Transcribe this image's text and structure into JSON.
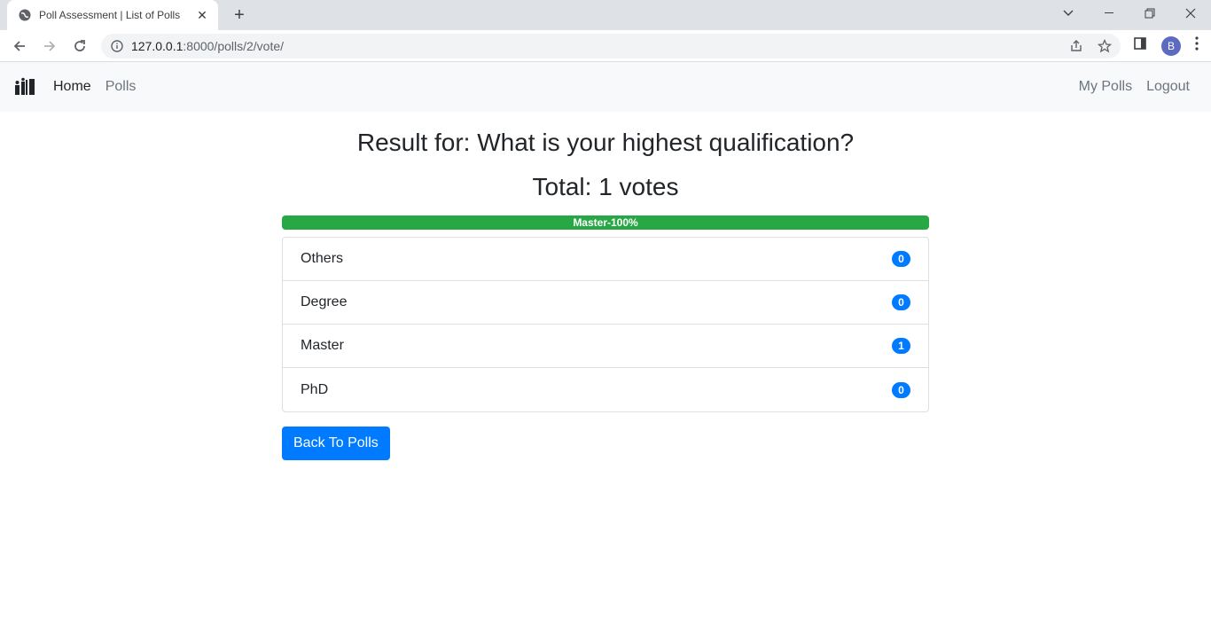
{
  "browser": {
    "tab_title": "Poll Assessment | List of Polls",
    "url_host": "127.0.0.1",
    "url_path": ":8000/polls/2/vote/",
    "profile_initial": "B"
  },
  "navbar": {
    "home": "Home",
    "polls": "Polls",
    "my_polls": "My Polls",
    "logout": "Logout"
  },
  "main": {
    "result_title": "Result for: What is your highest qualification?",
    "total": "Total: 1 votes",
    "progress": {
      "label": "Master-100%",
      "percent": 100,
      "color": "#28a745"
    },
    "choices": [
      {
        "label": "Others",
        "votes": "0"
      },
      {
        "label": "Degree",
        "votes": "0"
      },
      {
        "label": "Master",
        "votes": "1"
      },
      {
        "label": "PhD",
        "votes": "0"
      }
    ],
    "back_button": "Back To Polls"
  },
  "colors": {
    "accent": "#007bff",
    "success": "#28a745"
  }
}
